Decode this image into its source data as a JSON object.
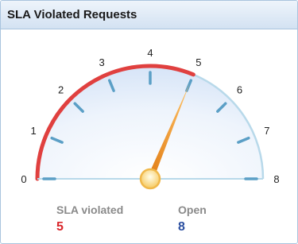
{
  "widget": {
    "title": "SLA Violated Requests"
  },
  "gauge": {
    "min": 0,
    "max": 8,
    "tick_labels": [
      "0",
      "1",
      "2",
      "3",
      "4",
      "5",
      "6",
      "7",
      "8"
    ],
    "violated_value": 5,
    "colors": {
      "violated_arc": "#e0403f",
      "remaining_arc": "#b8d9ea",
      "tick": "#5b9fc6",
      "needle": "#f39c2b",
      "pivot": "#f8d77a"
    }
  },
  "legend": {
    "violated_label": "SLA violated",
    "violated_value": "5",
    "violated_color": "#d9262b",
    "open_label": "Open",
    "open_value": "8",
    "open_color": "#2b4fa0"
  }
}
